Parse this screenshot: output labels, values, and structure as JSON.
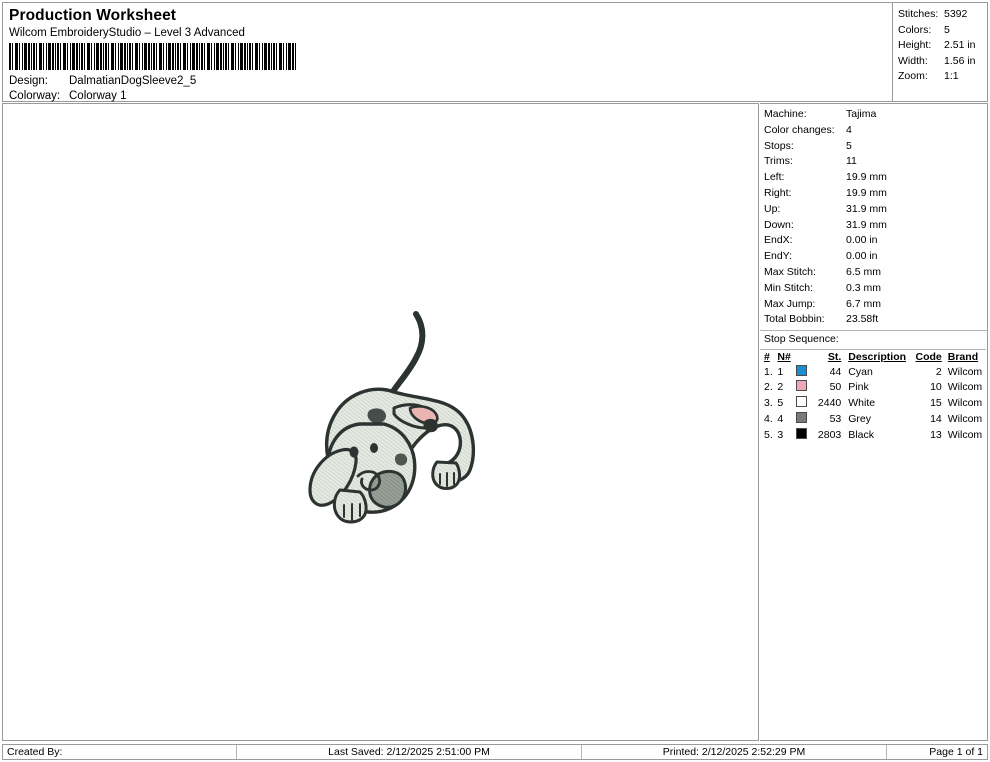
{
  "header": {
    "title": "Production Worksheet",
    "subtitle": "Wilcom EmbroideryStudio – Level 3 Advanced",
    "barcode_icon": "barcode-icon",
    "design_label": "Design:",
    "design_value": "DalmatianDogSleeve2_5",
    "colorway_label": "Colorway:",
    "colorway_value": "Colorway 1"
  },
  "stats": [
    {
      "label": "Stitches:",
      "value": "5392"
    },
    {
      "label": "Colors:",
      "value": "5"
    },
    {
      "label": "Height:",
      "value": "2.51 in"
    },
    {
      "label": "Width:",
      "value": "1.56 in"
    },
    {
      "label": "Zoom:",
      "value": "1:1"
    }
  ],
  "machine_info": [
    {
      "label": "Machine:",
      "value": "Tajima"
    },
    {
      "label": "Color changes:",
      "value": "4"
    },
    {
      "label": "Stops:",
      "value": "5"
    },
    {
      "label": "Trims:",
      "value": "11"
    },
    {
      "label": "Left:",
      "value": "19.9 mm"
    },
    {
      "label": "Right:",
      "value": "19.9 mm"
    },
    {
      "label": "Up:",
      "value": "31.9 mm"
    },
    {
      "label": "Down:",
      "value": "31.9 mm"
    },
    {
      "label": "EndX:",
      "value": "0.00 in"
    },
    {
      "label": "EndY:",
      "value": "0.00 in"
    },
    {
      "label": "Max Stitch:",
      "value": "6.5 mm"
    },
    {
      "label": "Min Stitch:",
      "value": "0.3 mm"
    },
    {
      "label": "Max Jump:",
      "value": "6.7 mm"
    },
    {
      "label": "Total Bobbin:",
      "value": "23.58ft"
    }
  ],
  "stop_sequence": {
    "title": "Stop Sequence:",
    "columns": [
      "#",
      "N#",
      "",
      "St.",
      "Description",
      "Code",
      "Brand"
    ],
    "rows": [
      {
        "num": "1.",
        "nnum": "1",
        "color": "#1a8fd0",
        "st": "44",
        "description": "Cyan",
        "code": "2",
        "brand": "Wilcom"
      },
      {
        "num": "2.",
        "nnum": "2",
        "color": "#f0a6b4",
        "st": "50",
        "description": "Pink",
        "code": "10",
        "brand": "Wilcom"
      },
      {
        "num": "3.",
        "nnum": "5",
        "color": "#ffffff",
        "st": "2440",
        "description": "White",
        "code": "15",
        "brand": "Wilcom"
      },
      {
        "num": "4.",
        "nnum": "4",
        "color": "#7a7a7a",
        "st": "53",
        "description": "Grey",
        "code": "14",
        "brand": "Wilcom"
      },
      {
        "num": "5.",
        "nnum": "3",
        "color": "#000000",
        "st": "2803",
        "description": "Black",
        "code": "13",
        "brand": "Wilcom"
      }
    ]
  },
  "design": {
    "name": "dalmatian-dog-artwork",
    "fill_color": "#e3e7de",
    "outline_color": "#2c3330",
    "tongue_color": "#e8b0ad",
    "spot_color": "#8f9990"
  },
  "footer": {
    "created_by": "Created By:",
    "last_saved": "Last Saved: 2/12/2025 2:51:00 PM",
    "printed": "Printed: 2/12/2025 2:52:29 PM",
    "page": "Page 1 of 1"
  }
}
